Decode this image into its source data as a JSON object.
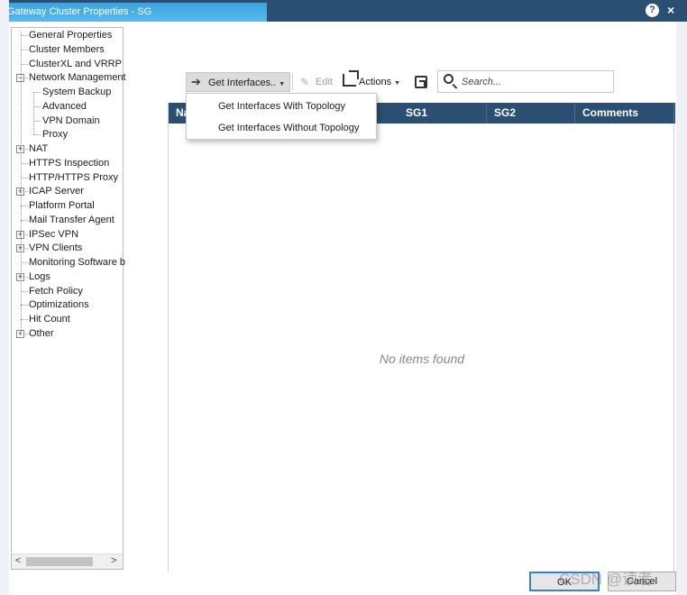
{
  "window": {
    "title": "Gateway Cluster Properties - SG",
    "help_label": "?",
    "close_label": "×"
  },
  "tree": {
    "items": [
      {
        "label": "General Properties",
        "expander": ""
      },
      {
        "label": "Cluster Members",
        "expander": ""
      },
      {
        "label": "ClusterXL and VRRP",
        "expander": ""
      },
      {
        "label": "Network Management",
        "expander": "−"
      },
      {
        "label": "System Backup",
        "expander": ""
      },
      {
        "label": "Advanced",
        "expander": ""
      },
      {
        "label": "VPN Domain",
        "expander": ""
      },
      {
        "label": "Proxy",
        "expander": ""
      },
      {
        "label": "NAT",
        "expander": "+"
      },
      {
        "label": "HTTPS Inspection",
        "expander": ""
      },
      {
        "label": "HTTP/HTTPS Proxy",
        "expander": ""
      },
      {
        "label": "ICAP Server",
        "expander": "+"
      },
      {
        "label": "Platform Portal",
        "expander": ""
      },
      {
        "label": "Mail Transfer Agent",
        "expander": ""
      },
      {
        "label": "IPSec VPN",
        "expander": "+"
      },
      {
        "label": "VPN Clients",
        "expander": "+"
      },
      {
        "label": "Monitoring Software b",
        "expander": ""
      },
      {
        "label": "Logs",
        "expander": "+"
      },
      {
        "label": "Fetch Policy",
        "expander": ""
      },
      {
        "label": "Optimizations",
        "expander": ""
      },
      {
        "label": "Hit Count",
        "expander": ""
      },
      {
        "label": "Other",
        "expander": "+"
      }
    ],
    "selected": "Network Management"
  },
  "toolbar": {
    "get_interfaces_label": "Get Interfaces..",
    "edit_label": "Edit",
    "actions_label": "Actions",
    "search_placeholder": "Search..."
  },
  "dropdown": {
    "options": [
      "Get Interfaces With Topology",
      "Get Interfaces Without Topology"
    ]
  },
  "table": {
    "columns": [
      "Na",
      "SG1",
      "SG2",
      "Comments"
    ],
    "empty_text": "No items found"
  },
  "footer": {
    "ok_label": "OK",
    "cancel_label": "Cancel"
  },
  "watermark": "CSDN @读者",
  "colors": {
    "header": "#2b4f73",
    "accent": "#3aa3e0"
  }
}
